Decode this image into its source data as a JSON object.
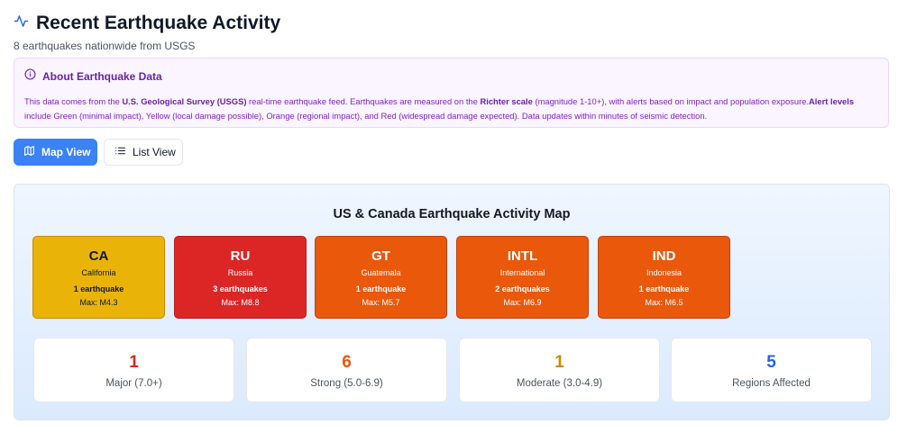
{
  "header": {
    "title": "Recent Earthquake Activity",
    "subtitle": "8 earthquakes nationwide from USGS",
    "icon": "activity-icon"
  },
  "info": {
    "title": "About Earthquake Data",
    "text_1": "This data comes from the ",
    "bold_1": "U.S. Geological Survey (USGS)",
    "text_2": " real-time earthquake feed. Earthquakes are measured on the ",
    "bold_2": "Richter scale",
    "text_3": " (magnitude 1-10+), with alerts based on impact and population exposure.",
    "bold_3": "Alert levels",
    "text_4": " include Green (minimal impact), Yellow (local damage possible), Orange (regional impact), and Red (widespread damage expected). Data updates within minutes of seismic detection."
  },
  "view_toggle": {
    "map_label": "Map View",
    "list_label": "List View"
  },
  "map": {
    "title": "US & Canada Earthquake Activity Map",
    "regions": [
      {
        "code": "CA",
        "name": "California",
        "count": "1 earthquake",
        "max": "Max: M4.3",
        "alert": "yellow"
      },
      {
        "code": "RU",
        "name": "Russia",
        "count": "3 earthquakes",
        "max": "Max: M8.8",
        "alert": "red"
      },
      {
        "code": "GT",
        "name": "Guatemala",
        "count": "1 earthquake",
        "max": "Max: M5.7",
        "alert": "orange"
      },
      {
        "code": "INTL",
        "name": "International",
        "count": "2 earthquakes",
        "max": "Max: M6.9",
        "alert": "orange"
      },
      {
        "code": "IND",
        "name": "Indonesia",
        "count": "1 earthquake",
        "max": "Max: M6.5",
        "alert": "orange"
      }
    ]
  },
  "stats": [
    {
      "value": "1",
      "label": "Major (7.0+)",
      "color": "#dc2626"
    },
    {
      "value": "6",
      "label": "Strong (5.0-6.9)",
      "color": "#ea580c"
    },
    {
      "value": "1",
      "label": "Moderate (3.0-4.9)",
      "color": "#ca8a04"
    },
    {
      "value": "5",
      "label": "Regions Affected",
      "color": "#2563eb"
    }
  ],
  "colors": {
    "primary": "#3b82f6",
    "info_bg": "#faf5ff",
    "info_text": "#7e22ce"
  }
}
